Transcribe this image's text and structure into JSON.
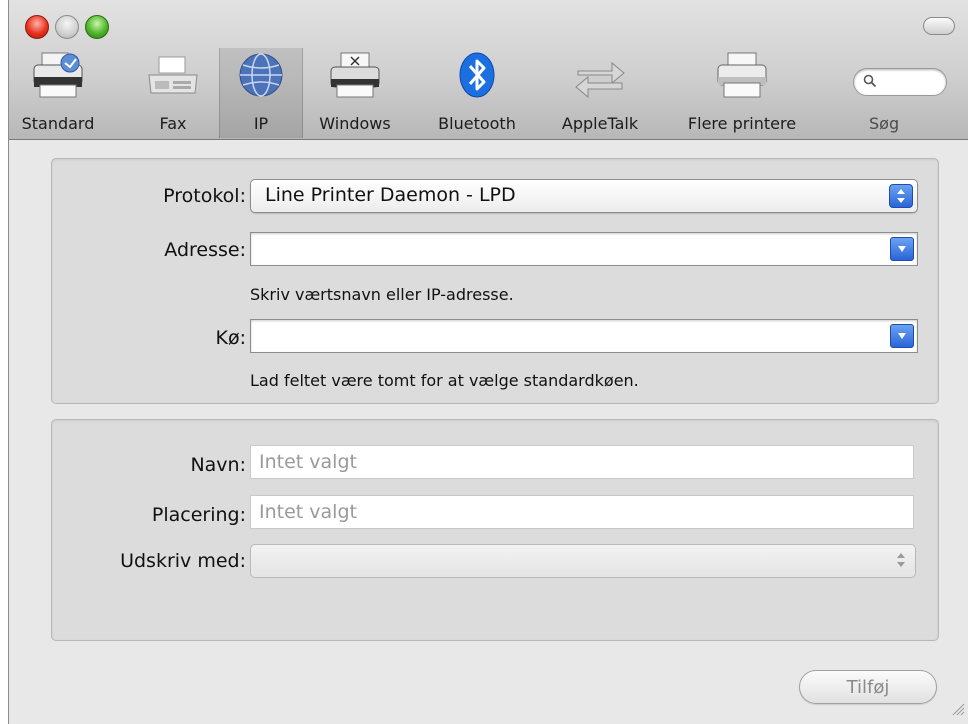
{
  "toolbar": {
    "items": [
      {
        "label": "Standard",
        "icon": "standard-printer-icon"
      },
      {
        "label": "Fax",
        "icon": "fax-icon"
      },
      {
        "label": "IP",
        "icon": "ip-globe-icon",
        "selected": true
      },
      {
        "label": "Windows",
        "icon": "windows-printer-icon"
      },
      {
        "label": "Bluetooth",
        "icon": "bluetooth-icon"
      },
      {
        "label": "AppleTalk",
        "icon": "appletalk-arrows-icon"
      },
      {
        "label": "Flere printere",
        "icon": "more-printers-icon"
      }
    ],
    "search_label": "Søg"
  },
  "protocol": {
    "label": "Protokol:",
    "value": "Line Printer Daemon - LPD"
  },
  "address": {
    "label": "Adresse:",
    "value": "",
    "hint": "Skriv værtsnavn eller IP-adresse."
  },
  "queue": {
    "label": "Kø:",
    "value": "",
    "hint": "Lad feltet være tomt for at vælge standardkøen."
  },
  "name": {
    "label": "Navn:",
    "placeholder": "Intet valgt"
  },
  "location": {
    "label": "Placering:",
    "placeholder": "Intet valgt"
  },
  "print_using": {
    "label": "Udskriv med:",
    "value": ""
  },
  "add_button": "Tilføj",
  "colors": {
    "accent_blue": "#2a64d8",
    "close_red": "#e8321f",
    "zoom_green": "#4eb52c"
  }
}
